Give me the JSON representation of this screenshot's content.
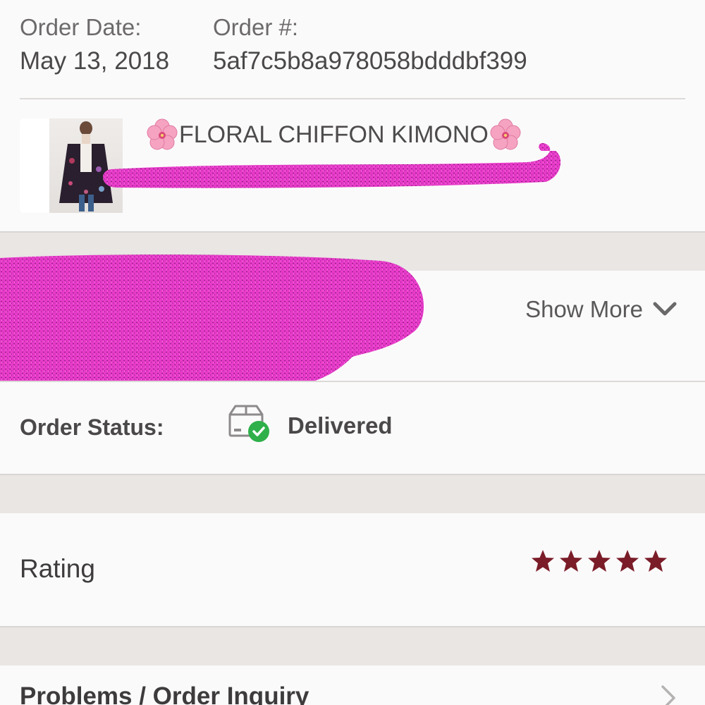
{
  "order": {
    "date_label": "Order Date:",
    "date_value": "May 13, 2018",
    "number_label": "Order #:",
    "number_value": "5af7c5b8a978058bdddbf399"
  },
  "product": {
    "title": "FLORAL CHIFFON KIMONO",
    "emoji": "🌸"
  },
  "details": {
    "show_more_label": "Show More"
  },
  "status": {
    "label": "Order Status:",
    "value": "Delivered",
    "accent_color": "#2fb04a"
  },
  "rating": {
    "label": "Rating",
    "stars": 5,
    "max_stars": 5,
    "star_color": "#7a1d28"
  },
  "problems": {
    "label": "Problems / Order Inquiry"
  },
  "colors": {
    "background": "#e9e6e3",
    "card": "#fbfafb",
    "redaction": "#e63bc9"
  }
}
